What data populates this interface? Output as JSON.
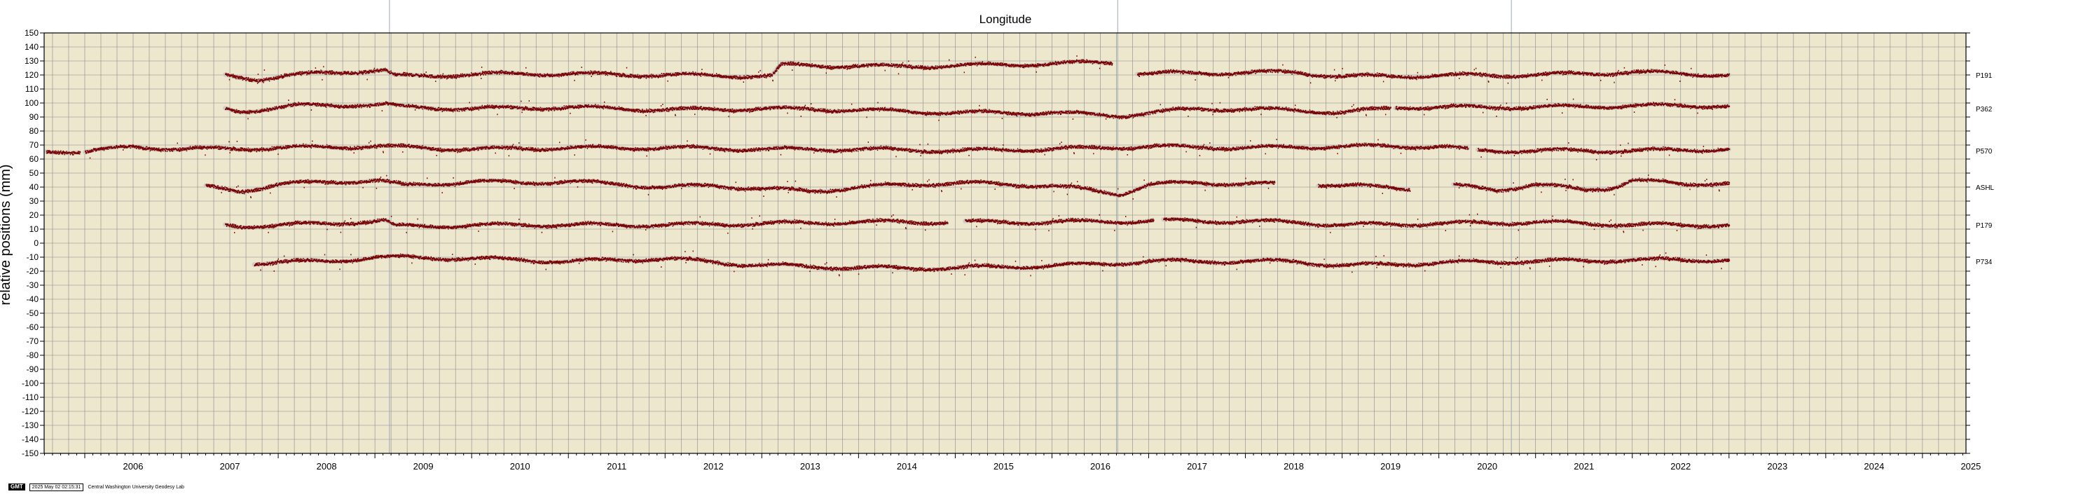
{
  "chart_data": {
    "type": "scatter",
    "title": "Longitude",
    "ylabel": "relative positions (mm)",
    "ylim": [
      -150,
      150
    ],
    "xlim": [
      2005.58,
      2025.45
    ],
    "y_ticks": [
      -150,
      -140,
      -130,
      -120,
      -110,
      -100,
      -90,
      -80,
      -70,
      -60,
      -50,
      -40,
      -30,
      -20,
      -10,
      0,
      10,
      20,
      30,
      40,
      50,
      60,
      70,
      80,
      90,
      100,
      110,
      120,
      130,
      140,
      150
    ],
    "x_tick_labels": [
      "2006",
      "2007",
      "2008",
      "2009",
      "2010",
      "2011",
      "2012",
      "2013",
      "2014",
      "2015",
      "2016",
      "2017",
      "2018",
      "2019",
      "2020",
      "2021",
      "2022",
      "2023",
      "2024",
      "2025"
    ],
    "grid": true,
    "colors": {
      "plot_background": "#ede7ce",
      "grid": "#888888",
      "points": "#7a0000",
      "trend": "#c9c9c9",
      "vertical_event": "#9aa6b8"
    },
    "vertical_lines": [
      2009.15,
      2016.68,
      2020.75
    ],
    "series": [
      {
        "name": "P191",
        "offset": 120,
        "spans": [
          [
            2007.45,
            2016.62
          ],
          [
            2016.88,
            2023.0
          ]
        ],
        "shape": [
          [
            2007.45,
            0
          ],
          [
            2007.8,
            -3
          ],
          [
            2008.5,
            2
          ],
          [
            2009.1,
            3
          ],
          [
            2009.2,
            -1
          ],
          [
            2010.5,
            1
          ],
          [
            2012.0,
            0
          ],
          [
            2013.1,
            -1
          ],
          [
            2013.2,
            7
          ],
          [
            2014.5,
            6
          ],
          [
            2016.0,
            8
          ],
          [
            2016.6,
            9
          ],
          [
            2016.9,
            1
          ],
          [
            2018.5,
            2
          ],
          [
            2019.0,
            -1
          ],
          [
            2021.0,
            0
          ],
          [
            2022.0,
            2
          ],
          [
            2023.0,
            0
          ]
        ]
      },
      {
        "name": "P362",
        "offset": 96,
        "spans": [
          [
            2007.45,
            2019.5
          ],
          [
            2019.55,
            2023.0
          ]
        ],
        "shape": [
          [
            2007.45,
            0
          ],
          [
            2007.6,
            -2
          ],
          [
            2008.2,
            2
          ],
          [
            2009.1,
            3
          ],
          [
            2009.3,
            1
          ],
          [
            2010.0,
            0
          ],
          [
            2011.0,
            1
          ],
          [
            2012.0,
            -1
          ],
          [
            2013.0,
            0
          ],
          [
            2014.0,
            -1
          ],
          [
            2015.0,
            -3
          ],
          [
            2016.0,
            -3
          ],
          [
            2016.7,
            -5
          ],
          [
            2017.5,
            0
          ],
          [
            2018.5,
            -1
          ],
          [
            2019.0,
            -3
          ],
          [
            2019.6,
            1
          ],
          [
            2021.0,
            1
          ],
          [
            2022.0,
            2
          ],
          [
            2023.0,
            2
          ]
        ]
      },
      {
        "name": "P570",
        "offset": 66,
        "spans": [
          [
            2005.6,
            2005.95
          ],
          [
            2006.0,
            2020.3
          ],
          [
            2020.4,
            2023.0
          ]
        ],
        "shape": [
          [
            2005.6,
            0
          ],
          [
            2006.0,
            -1
          ],
          [
            2006.5,
            3
          ],
          [
            2007.0,
            1
          ],
          [
            2008.0,
            2
          ],
          [
            2009.0,
            3
          ],
          [
            2010.0,
            1
          ],
          [
            2011.0,
            2
          ],
          [
            2012.0,
            2
          ],
          [
            2013.0,
            1
          ],
          [
            2014.0,
            1
          ],
          [
            2015.0,
            0
          ],
          [
            2016.0,
            1
          ],
          [
            2017.0,
            3
          ],
          [
            2018.0,
            2
          ],
          [
            2019.0,
            3
          ],
          [
            2020.0,
            3
          ],
          [
            2020.4,
            0
          ],
          [
            2021.0,
            0
          ],
          [
            2022.0,
            0
          ],
          [
            2023.0,
            1
          ]
        ]
      },
      {
        "name": "ASHL",
        "offset": 40,
        "spans": [
          [
            2007.25,
            2018.3
          ],
          [
            2018.75,
            2019.7
          ],
          [
            2020.15,
            2023.0
          ]
        ],
        "shape": [
          [
            2007.25,
            0
          ],
          [
            2007.6,
            -3
          ],
          [
            2008.0,
            2
          ],
          [
            2009.0,
            5
          ],
          [
            2009.3,
            1
          ],
          [
            2010.0,
            4
          ],
          [
            2010.5,
            3
          ],
          [
            2011.0,
            4
          ],
          [
            2012.0,
            0
          ],
          [
            2012.5,
            1
          ],
          [
            2013.0,
            -1
          ],
          [
            2013.5,
            -3
          ],
          [
            2014.0,
            0
          ],
          [
            2015.0,
            3
          ],
          [
            2016.0,
            1
          ],
          [
            2016.7,
            -5
          ],
          [
            2017.0,
            2
          ],
          [
            2017.5,
            3
          ],
          [
            2018.3,
            2
          ],
          [
            2018.75,
            2
          ],
          [
            2019.7,
            -1
          ],
          [
            2020.15,
            1
          ],
          [
            2020.6,
            -2
          ],
          [
            2021.0,
            2
          ],
          [
            2021.5,
            -2
          ],
          [
            2021.8,
            0
          ],
          [
            2022.0,
            5
          ],
          [
            2022.5,
            2
          ],
          [
            2023.0,
            3
          ]
        ]
      },
      {
        "name": "P179",
        "offset": 13,
        "spans": [
          [
            2007.45,
            2014.92
          ],
          [
            2015.1,
            2017.05
          ],
          [
            2017.15,
            2023.0
          ]
        ],
        "shape": [
          [
            2007.45,
            0
          ],
          [
            2007.6,
            -1
          ],
          [
            2008.5,
            1
          ],
          [
            2009.1,
            3
          ],
          [
            2009.2,
            -1
          ],
          [
            2010.5,
            0
          ],
          [
            2012.0,
            0
          ],
          [
            2013.0,
            1
          ],
          [
            2014.0,
            2
          ],
          [
            2015.0,
            2
          ],
          [
            2016.0,
            2
          ],
          [
            2017.2,
            3
          ],
          [
            2018.5,
            2
          ],
          [
            2019.0,
            0
          ],
          [
            2020.0,
            1
          ],
          [
            2021.0,
            2
          ],
          [
            2022.0,
            0
          ],
          [
            2023.0,
            0
          ]
        ]
      },
      {
        "name": "P734",
        "offset": -13,
        "spans": [
          [
            2007.75,
            2023.0
          ]
        ],
        "shape": [
          [
            2007.75,
            -1
          ],
          [
            2008.5,
            0
          ],
          [
            2009.0,
            3
          ],
          [
            2010.0,
            2
          ],
          [
            2011.0,
            0
          ],
          [
            2012.0,
            2
          ],
          [
            2012.8,
            -2
          ],
          [
            2013.5,
            -4
          ],
          [
            2014.5,
            -5
          ],
          [
            2015.5,
            -4
          ],
          [
            2016.5,
            -2
          ],
          [
            2017.0,
            0
          ],
          [
            2018.5,
            0
          ],
          [
            2019.0,
            -3
          ],
          [
            2020.0,
            -1
          ],
          [
            2021.0,
            0
          ],
          [
            2022.0,
            1
          ],
          [
            2023.0,
            1
          ]
        ]
      }
    ]
  },
  "footer": {
    "badge": "GMT",
    "timestamp": "2025 May 02 02:15:31",
    "lab": "Central Washington University Geodesy Lab"
  }
}
